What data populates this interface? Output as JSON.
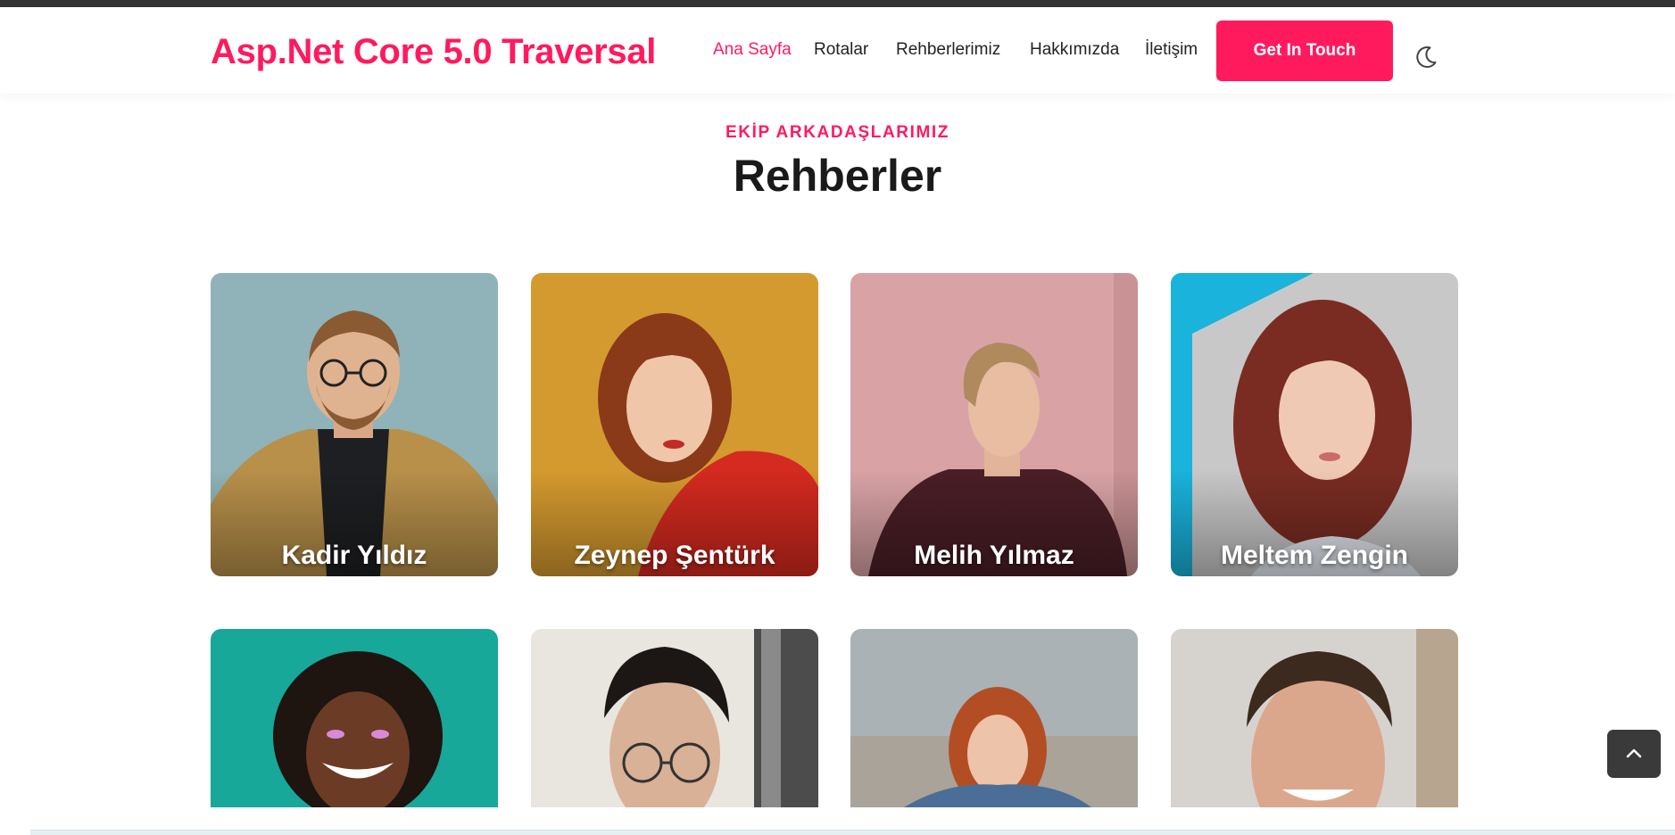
{
  "header": {
    "logo": "Asp.Net Core 5.0 Traversal",
    "nav": [
      "Ana Sayfa",
      "Rotalar",
      "Rehberlerimiz",
      "Hakkımızda",
      "İletişim"
    ],
    "active_nav": "Ana Sayfa",
    "cta_label": "Get In Touch",
    "theme_toggle_icon": "moon-icon"
  },
  "section": {
    "eyebrow": "EKİP ARKADAŞLARIMIZ",
    "title": "Rehberler"
  },
  "guides": [
    {
      "name": "Kadir Yıldız",
      "bg": "#8fb3b8"
    },
    {
      "name": "Zeynep Şentürk",
      "bg": "#d59a2f"
    },
    {
      "name": "Melih Yılmaz",
      "bg": "#d9a3a6"
    },
    {
      "name": "Meltem Zengin",
      "bg": "#c8c8c8"
    },
    {
      "name": "",
      "bg": "#17a89a"
    },
    {
      "name": "",
      "bg": "#e9e6df"
    },
    {
      "name": "",
      "bg": "#aab2b5"
    },
    {
      "name": "",
      "bg": "#d6d3cf"
    }
  ],
  "scroll_top_icon": "chevron-up-icon",
  "colors": {
    "accent": "#ff1a5e",
    "text": "#1a1a1a",
    "dark_button": "#3a3a3a"
  }
}
